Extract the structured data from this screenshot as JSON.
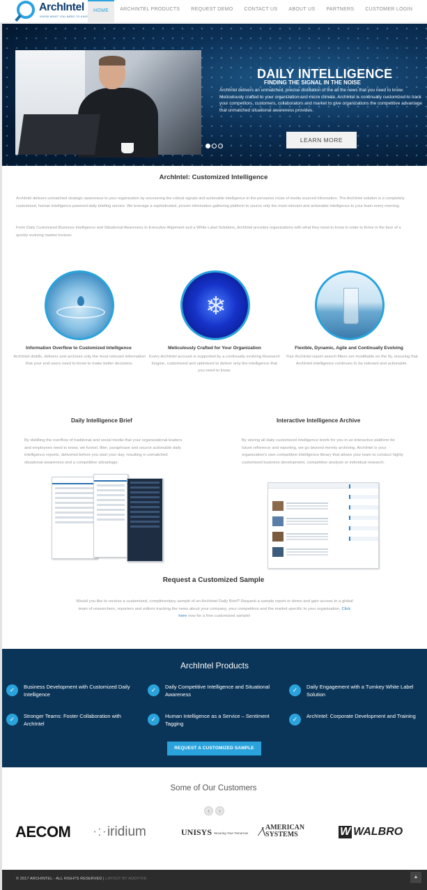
{
  "logo": {
    "name": "ArchIntel",
    "tagline": "KNOW WHAT YOU NEED TO KNOW"
  },
  "nav": {
    "items": [
      "HOME",
      "ARCHINTEL PRODUCTS",
      "REQUEST DEMO",
      "CONTACT US",
      "ABOUT US",
      "PARTNERS",
      "CUSTOMER LOGIN"
    ],
    "active": "HOME"
  },
  "hero": {
    "title": "DAILY INTELLIGENCE",
    "subtitle": "FINDING THE SIGNAL IN THE NOISE",
    "body": "ArchIntel delivers an unmatched, precise distillation of the all the news that you need to know. Meticulously crafted to your organization and micro climate, ArchIntel is continually customized to track your competitors, customers, collaborators and market to give organizations the competitive advantage that unmatched situational awareness provides.",
    "button": "LEARN MORE"
  },
  "intro": {
    "title": "ArchIntel: Customized Intelligence",
    "p1": "ArchIntel delivers unmatched strategic awareness to your organization by uncovering the critical signals and actionable intelligence in the pervasive noise of media sourced information. The ArchIntel solution is a completely customized, human intelligence powered daily briefing service. We leverage a sophisticated, proven information gathering platform to source only the most relevant and actionable intelligence to your team every morning.",
    "p2": "From Daily Customized Business Intelligence and Situational Awareness to Executive Alignment and a White Label Solutions, ArchIntel provides organizations with what they need to know in order to thrive in the face of a quickly evolving market horizon."
  },
  "features": [
    {
      "title": "Information Overflow to Customized Intelligence",
      "desc": "ArchIntel distills, delivers and archives only the most relevant information that your end users need to know to make better decisions."
    },
    {
      "title": "Meticulously Crafted for Your Organization",
      "desc": "Every ArchIntel account is supported by a continually evolving Research Engine, customized and optimized to deliver only the intelligence that you need to know."
    },
    {
      "title": "Flexible, Dynamic, Agile and Continually Evolving",
      "desc": "Your ArchIntel report search filters are modifiable on the fly, ensuring that ArchIntel intelligence continues to be relevant and actionable."
    }
  ],
  "brief": {
    "title": "Daily Intelligence Brief",
    "body": "By distilling the overflow of traditional and social media that your organizational leaders and employees need to know, we funnel, filter, paraphrase and source actionable daily intelligence reports, delivered before you start your day, resulting in unmatched situational awareness and a competitive advantage."
  },
  "archive": {
    "title": "Interactive Intelligence Archive",
    "body": "By storing all daily customized intelligence briefs for you in an interactive platform for future reference and reporting, we go beyond merely archiving. ArchIntel is your organization's own competitive intelligence library that allows your team to conduct highly customized business development, competitive analysis or individual research."
  },
  "sample": {
    "title": "Request a Customized Sample",
    "body": "Would you like to receive a customized, complimentary sample of an ArchIntel Daily Brief? Request a sample report or demo and gain access to a global team of researchers, reporters and editors tracking the news about your company, your competitors and the market specific to your organization.",
    "link": "Click here",
    "tail": " now for a free customized sample!"
  },
  "products": {
    "title": "ArchIntel Products",
    "items": [
      "Business Development with Customized Daily Intelligence",
      "Daily Competitive Intelligence and Situational Awareness",
      "Daily Engagement with a Turnkey White Label Solution",
      "Stronger Teams: Foster Collaboration with ArchIntel",
      "Human Intelligence as a Service – Sentiment Tagging",
      "ArchIntel: Corporate Development and Training"
    ],
    "button": "REQUEST A CUSTOMIZED SAMPLE"
  },
  "customers": {
    "title": "Some of Our Customers",
    "logos": [
      "AECOM",
      "iridium",
      "UNISYS",
      "AMERICAN SYSTEMS",
      "WALBRO"
    ],
    "unisys_tag": "Securing Your Tomorrow"
  },
  "footer": {
    "copyright": "© 2017 ARCHINTEL - ALL RIGHTS RESERVED |",
    "credit": "LAYOUT BY ADDITIVE"
  },
  "colors": {
    "accent": "#2aa3dc",
    "navy": "#0b3558",
    "footer": "#2c2c2c"
  }
}
